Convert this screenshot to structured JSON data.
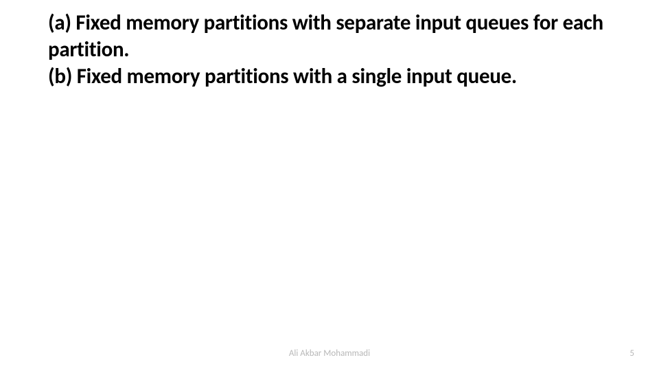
{
  "title": {
    "line_a": "(a) Fixed memory partitions with separate input queues for each partition.",
    "line_b": "(b) Fixed memory partitions with a single input queue."
  },
  "footer": {
    "author": "Ali Akbar Mohammadi",
    "page_number": "5"
  }
}
